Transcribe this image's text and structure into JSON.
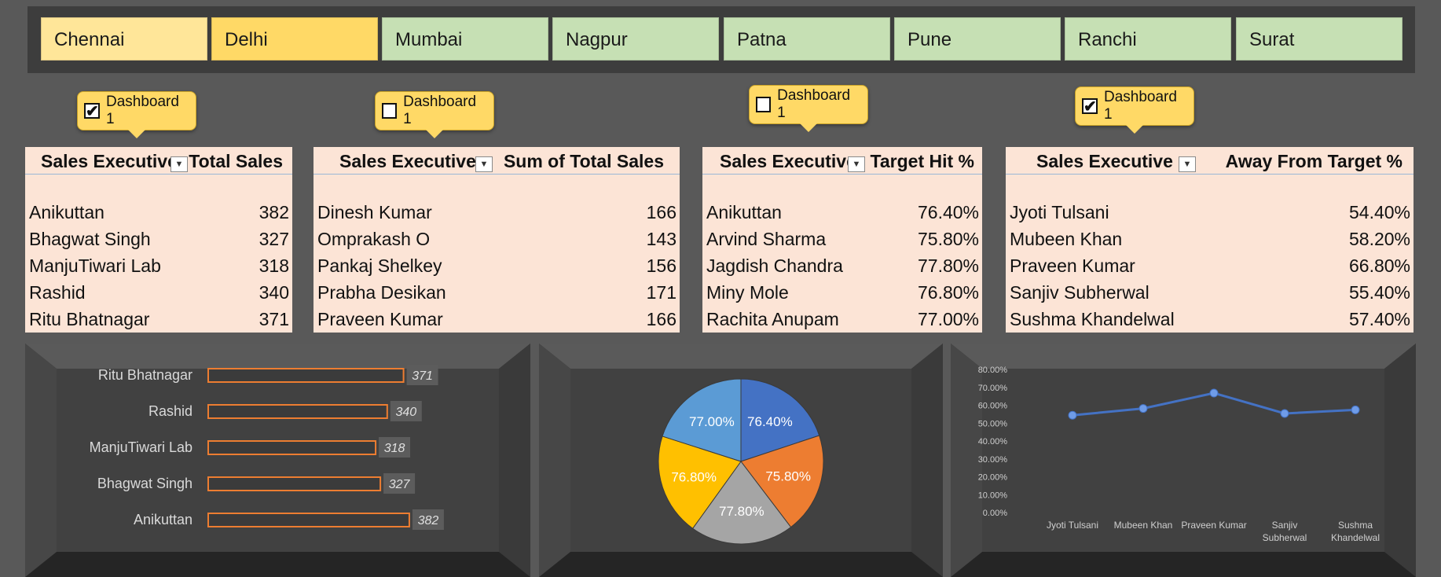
{
  "slicer": {
    "items": [
      {
        "label": "Chennai",
        "state": "selected-light"
      },
      {
        "label": "Delhi",
        "state": "selected"
      },
      {
        "label": "Mumbai",
        "state": "unselected"
      },
      {
        "label": "Nagpur",
        "state": "unselected"
      },
      {
        "label": "Patna",
        "state": "unselected"
      },
      {
        "label": "Pune",
        "state": "unselected"
      },
      {
        "label": "Ranchi",
        "state": "unselected"
      },
      {
        "label": "Surat",
        "state": "unselected"
      }
    ]
  },
  "callouts": [
    {
      "label": "Dashboard 1",
      "checked": true,
      "mark": "✔"
    },
    {
      "label": "Dashboard 1",
      "checked": false,
      "mark": ""
    },
    {
      "label": "Dashboard 1",
      "checked": false,
      "mark": ""
    },
    {
      "label": "Dashboard 1",
      "checked": true,
      "mark": "✔"
    }
  ],
  "tables": [
    {
      "col1": "Sales Executive",
      "col2": "Total Sales",
      "rows": [
        [
          "Anikuttan",
          "382"
        ],
        [
          "Bhagwat Singh",
          "327"
        ],
        [
          "ManjuTiwari Lab",
          "318"
        ],
        [
          "Rashid",
          "340"
        ],
        [
          "Ritu Bhatnagar",
          "371"
        ]
      ]
    },
    {
      "col1": "Sales Executive",
      "col2": "Sum of Total Sales",
      "rows": [
        [
          "Dinesh Kumar",
          "166"
        ],
        [
          "Omprakash O",
          "143"
        ],
        [
          "Pankaj Shelkey",
          "156"
        ],
        [
          "Prabha Desikan",
          "171"
        ],
        [
          "Praveen Kumar",
          "166"
        ]
      ]
    },
    {
      "col1": "Sales Executive",
      "col2": "Target Hit %",
      "rows": [
        [
          "Anikuttan",
          "76.40%"
        ],
        [
          "Arvind Sharma",
          "75.80%"
        ],
        [
          "Jagdish Chandra",
          "77.80%"
        ],
        [
          "Miny Mole",
          "76.80%"
        ],
        [
          "Rachita Anupam",
          "77.00%"
        ]
      ]
    },
    {
      "col1": "Sales Executive",
      "col2": "Away From Target %",
      "rows": [
        [
          "Jyoti Tulsani",
          "54.40%"
        ],
        [
          "Mubeen Khan",
          "58.20%"
        ],
        [
          "Praveen Kumar",
          "66.80%"
        ],
        [
          "Sanjiv Subherwal",
          "55.40%"
        ],
        [
          "Sushma Khandelwal",
          "57.40%"
        ]
      ]
    }
  ],
  "colors": {
    "bar_outline": "#ed7d31",
    "line": "#4472c4",
    "pie": [
      "#4472c4",
      "#ed7d31",
      "#a5a5a5",
      "#ffc000",
      "#5b9bd5"
    ]
  },
  "chart_data": [
    {
      "type": "bar",
      "orientation": "horizontal",
      "categories": [
        "Ritu Bhatnagar",
        "Rashid",
        "ManjuTiwari Lab",
        "Bhagwat Singh",
        "Anikuttan"
      ],
      "values": [
        371,
        340,
        318,
        327,
        382
      ],
      "data_labels": [
        "371",
        "340",
        "318",
        "327",
        "382"
      ]
    },
    {
      "type": "pie",
      "categories": [
        "Anikuttan",
        "Arvind Sharma",
        "Jagdish Chandra",
        "Miny Mole",
        "Rachita Anupam"
      ],
      "values": [
        76.4,
        75.8,
        77.8,
        76.8,
        77.0
      ],
      "data_labels": [
        "76.40%",
        "75.80%",
        "77.80%",
        "76.80%",
        "77.00%"
      ]
    },
    {
      "type": "line",
      "categories": [
        "Jyoti Tulsani",
        "Mubeen Khan",
        "Praveen Kumar",
        "Sanjiv Subherwal",
        "Sushma Khandelwal"
      ],
      "values": [
        54.4,
        58.2,
        66.8,
        55.4,
        57.4
      ],
      "ylim": [
        0,
        80
      ],
      "yticks": [
        "0.00%",
        "10.00%",
        "20.00%",
        "30.00%",
        "40.00%",
        "50.00%",
        "60.00%",
        "70.00%",
        "80.00%"
      ],
      "grid": false
    }
  ]
}
